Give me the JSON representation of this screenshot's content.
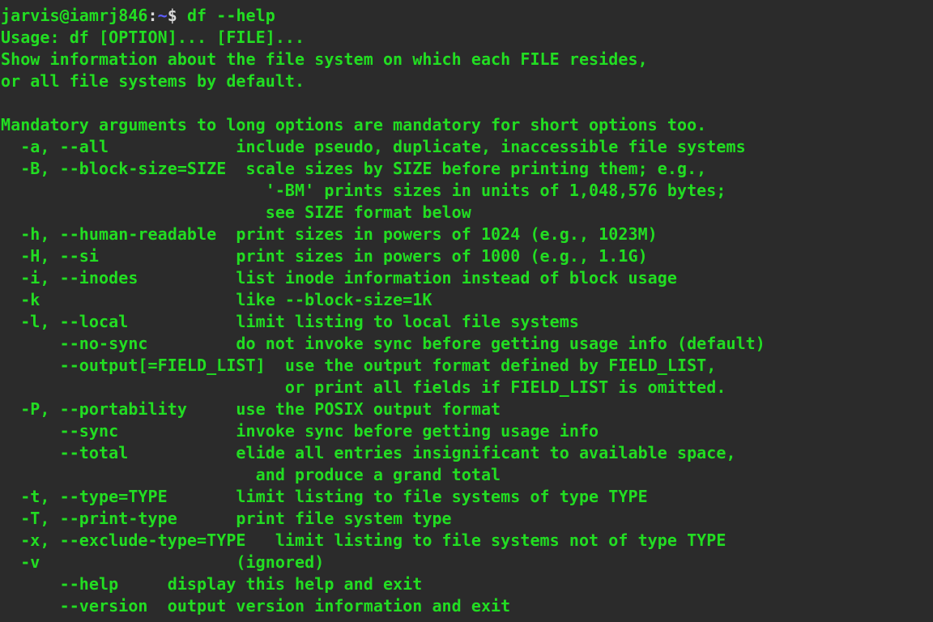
{
  "terminal": {
    "background_color": "#2b2b2b",
    "foreground_color": "#22dd22",
    "punct_color": "#d8d8d8",
    "tilde_color": "#5d5dff",
    "prompt": {
      "user_host": "jarvis@iamrj846",
      "colon": ":",
      "path": "~",
      "sigil": "$",
      "command": " df --help"
    },
    "output_lines": [
      "Usage: df [OPTION]... [FILE]...",
      "Show information about the file system on which each FILE resides,",
      "or all file systems by default.",
      "",
      "Mandatory arguments to long options are mandatory for short options too.",
      "  -a, --all             include pseudo, duplicate, inaccessible file systems",
      "  -B, --block-size=SIZE  scale sizes by SIZE before printing them; e.g.,",
      "                           '-BM' prints sizes in units of 1,048,576 bytes;",
      "                           see SIZE format below",
      "  -h, --human-readable  print sizes in powers of 1024 (e.g., 1023M)",
      "  -H, --si              print sizes in powers of 1000 (e.g., 1.1G)",
      "  -i, --inodes          list inode information instead of block usage",
      "  -k                    like --block-size=1K",
      "  -l, --local           limit listing to local file systems",
      "      --no-sync         do not invoke sync before getting usage info (default)",
      "      --output[=FIELD_LIST]  use the output format defined by FIELD_LIST,",
      "                             or print all fields if FIELD_LIST is omitted.",
      "  -P, --portability     use the POSIX output format",
      "      --sync            invoke sync before getting usage info",
      "      --total           elide all entries insignificant to available space,",
      "                          and produce a grand total",
      "  -t, --type=TYPE       limit listing to file systems of type TYPE",
      "  -T, --print-type      print file system type",
      "  -x, --exclude-type=TYPE   limit listing to file systems not of type TYPE",
      "  -v                    (ignored)",
      "      --help     display this help and exit",
      "      --version  output version information and exit"
    ]
  }
}
